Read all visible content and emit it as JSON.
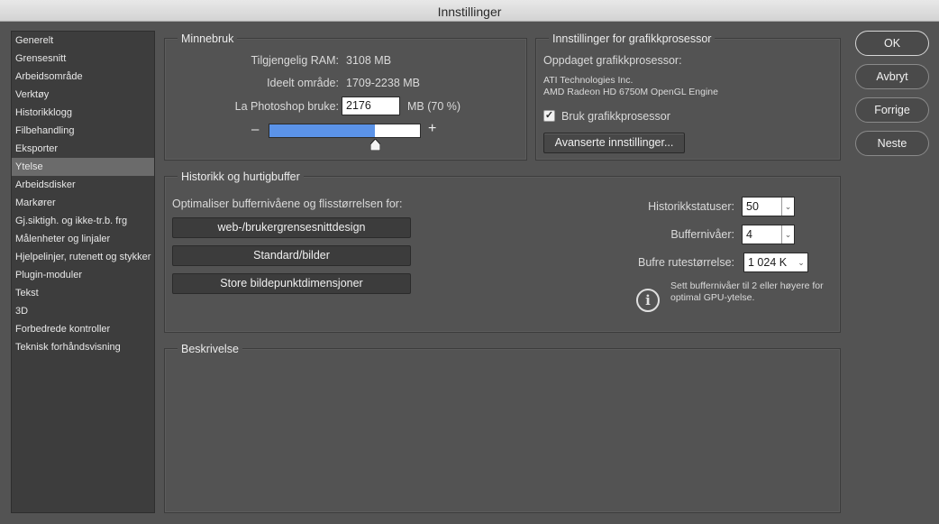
{
  "window": {
    "title": "Innstillinger"
  },
  "sidebar": {
    "items": [
      {
        "label": "Generelt"
      },
      {
        "label": "Grensesnitt"
      },
      {
        "label": "Arbeidsområde"
      },
      {
        "label": "Verktøy"
      },
      {
        "label": "Historikklogg"
      },
      {
        "label": "Filbehandling"
      },
      {
        "label": "Eksporter"
      },
      {
        "label": "Ytelse"
      },
      {
        "label": "Arbeidsdisker"
      },
      {
        "label": "Markører"
      },
      {
        "label": "Gj.siktigh. og ikke-tr.b. frg"
      },
      {
        "label": "Målenheter og linjaler"
      },
      {
        "label": "Hjelpelinjer, rutenett og stykker"
      },
      {
        "label": "Plugin-moduler"
      },
      {
        "label": "Tekst"
      },
      {
        "label": "3D"
      },
      {
        "label": "Forbedrede kontroller"
      },
      {
        "label": "Teknisk forhåndsvisning"
      }
    ],
    "active": "Ytelse"
  },
  "memory": {
    "title": "Minnebruk",
    "available_label": "Tilgjengelig RAM:",
    "available_value": "3108 MB",
    "ideal_label": "Ideelt område:",
    "ideal_value": "1709-2238 MB",
    "use_label": "La Photoshop bruke:",
    "use_value": "2176",
    "use_unit": "MB (70 %)",
    "slider_fraction": 0.7,
    "minus": "–",
    "plus": "+"
  },
  "gpu": {
    "title": "Innstillinger for grafikkprosessor",
    "detected_label": "Oppdaget grafikkprosessor:",
    "vendor": "ATI Technologies Inc.",
    "model": "AMD Radeon HD 6750M OpenGL Engine",
    "use_gpu_label": "Bruk grafikkprosessor",
    "use_gpu_checked": true,
    "advanced_button": "Avanserte innstillinger..."
  },
  "history": {
    "title": "Historikk og hurtigbuffer",
    "optimize_label": "Optimaliser buffernivåene og flisstørrelsen for:",
    "buttons": [
      "web-/brukergrensesnittdesign",
      "Standard/bilder",
      "Store bildepunktdimensjoner"
    ],
    "states_label": "Historikkstatuser:",
    "states_value": "50",
    "levels_label": "Buffernivåer:",
    "levels_value": "4",
    "tile_label": "Bufre rutestørrelse:",
    "tile_value": "1 024 K",
    "info_text_1": "Sett buffernivåer til 2 eller høyere for",
    "info_text_2": "optimal GPU-ytelse."
  },
  "description": {
    "title": "Beskrivelse"
  },
  "dialog_buttons": {
    "ok": "OK",
    "cancel": "Avbryt",
    "prev": "Forrige",
    "next": "Neste"
  },
  "colors": {
    "accent": "#5b93e8",
    "panel": "#535353",
    "sidebar": "#3d3d3d",
    "active_item": "#6b6b6b"
  }
}
